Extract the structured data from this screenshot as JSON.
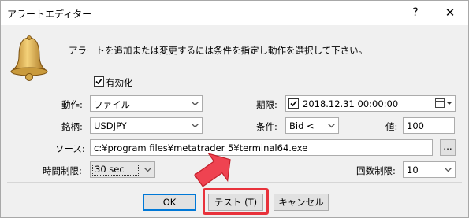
{
  "window": {
    "title": "アラートエディター",
    "help": "?",
    "close": "✕"
  },
  "description": "アラートを追加または変更するには条件を指定し動作を選択して下さい。",
  "enabled": {
    "label": "有効化",
    "checked": true
  },
  "action": {
    "label": "動作:",
    "value": "ファイル"
  },
  "expiry": {
    "label": "期限:",
    "checked": true,
    "value": "2018.12.31 00:00:00"
  },
  "symbol": {
    "label": "銘柄:",
    "value": "USDJPY"
  },
  "condition": {
    "label": "条件:",
    "value": "Bid <"
  },
  "value": {
    "label": "値:",
    "value": "100"
  },
  "source": {
    "label": "ソース:",
    "value": "c:¥program files¥metatrader 5¥terminal64.exe",
    "browse": "..."
  },
  "timeout": {
    "label": "時間制限:",
    "value": "30 sec"
  },
  "repeat": {
    "label": "回数制限:",
    "value": "10"
  },
  "buttons": {
    "ok": "OK",
    "test": "テスト (T)",
    "cancel": "キャンセル"
  },
  "colors": {
    "highlight": "#e8323b",
    "button_focus": "#0078d7",
    "arrow": "#ef4351"
  }
}
